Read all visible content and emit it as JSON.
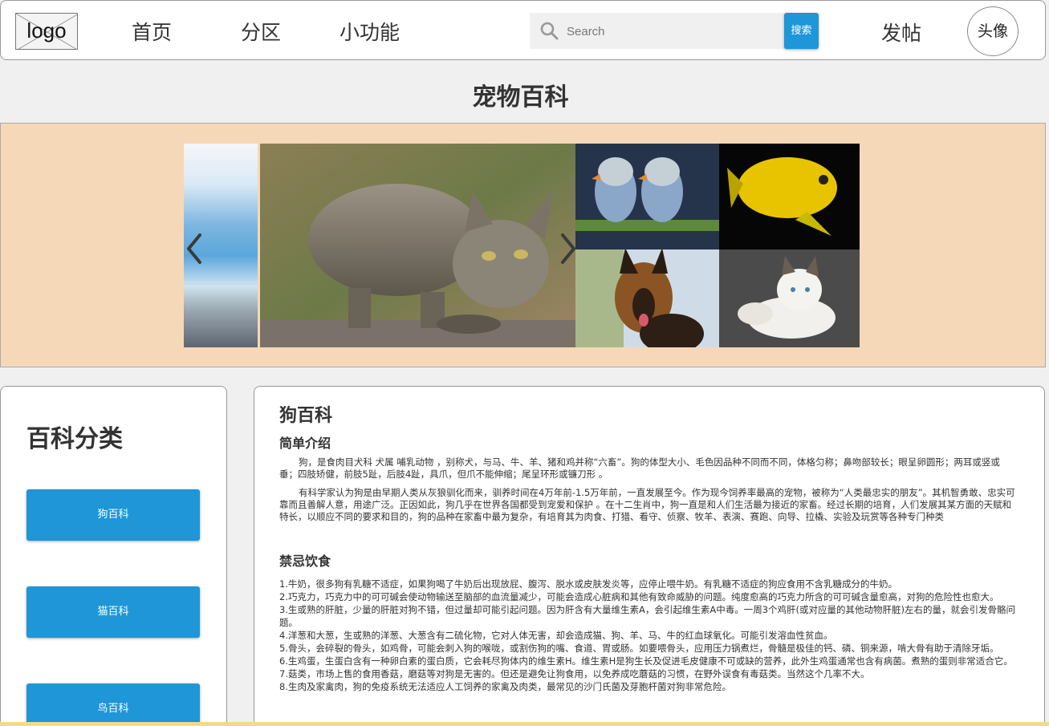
{
  "header": {
    "logo": "logo",
    "nav": [
      "首页",
      "分区",
      "小功能"
    ],
    "search_placeholder": "Search",
    "search_button": "搜索",
    "post_button": "发帖",
    "avatar": "头像"
  },
  "page_title": "宠物百科",
  "sidebar": {
    "title": "百科分类",
    "categories": [
      "狗百科",
      "猫百科",
      "鸟百科"
    ]
  },
  "content": {
    "title": "狗百科",
    "intro_heading": "简单介绍",
    "intro_paragraphs": [
      "狗，是食肉目犬科 犬属 哺乳动物 ，别称犬，与马、牛、羊、猪和鸡并称“六畜”。狗的体型大小、毛色因品种不同而不同，体格匀称；鼻吻部较长；眼呈卵圆形；两耳或竖或垂；四肢矫健，前肢5趾，后肢4趾，具爪，但爪不能伸缩；尾呈环形或镰刀形 。",
      "有科学家认为狗是由早期人类从灰狼驯化而来，驯养时间在4万年前-1.5万年前，一直发展至今。作为现今饲养率最高的宠物，被称为“人类最忠实的朋友”。其机智勇敢、忠实可靠而且善解人意，用途广泛。正因如此，狗几乎在世界各国都受到宠爱和保护 。在十二生肖中，狗一直是和人们生活最为接近的家畜。经过长期的培育，人们发展其某方面的天赋和特长，以顺应不同的要求和目的，狗的品种在家畜中最为复杂，有培育其为肉食、打猎、看守、侦察、牧羊、表演、赛跑、向导、拉橇、实验及玩赏等各种专门种类"
    ],
    "taboo_heading": "禁忌饮食",
    "taboo_items": [
      "1.牛奶，很多狗有乳糖不适症，如果狗喝了牛奶后出现放屁、腹泻、脱水或皮肤发炎等，应停止喂牛奶。有乳糖不适症的狗应食用不含乳糖成分的牛奶。",
      "2.巧克力，巧克力中的可可碱会使动物输送至脑部的血流量减少，可能会造成心脏病和其他有致命威胁的问题。纯度愈高的巧克力所含的可可碱含量愈高，对狗的危险性也愈大。",
      "3.生或熟的肝脏，少量的肝脏对狗不错，但过量却可能引起问题。因为肝含有大量维生素A，会引起维生素A中毒。一周3个鸡肝(或对应量的其他动物肝脏)左右的量，就会引发骨骼问题。",
      "4.洋葱和大葱，生或熟的洋葱、大葱含有二硫化物，它对人体无害，却会造成猫、狗、羊、马、牛的红血球氧化。可能引发溶血性贫血。",
      "5.骨头，会碎裂的骨头，如鸡骨，可能会刺入狗的喉咙，或割伤狗的嘴、食道、胃或肠。如要喂骨头，应用压力锅煮烂，骨髓是极佳的钙、磷、铜来源，啃大骨有助于清除牙垢。",
      "6.生鸡蛋，生蛋白含有一种卵白素的蛋白质，它会耗尽狗体内的维生素H。维生素H是狗生长及促进毛皮健康不可或缺的营养，此外生鸡蛋通常也含有病菌。煮熟的蛋则非常适合它。",
      "7.菇类，市场上售的食用香菇，磨菇等对狗是无害的。但还是避免让狗食用，以免养成吃蘑菇的习惯，在野外误食有毒菇类。当然这个几率不大。",
      "8.生肉及家禽肉，狗的免疫系统无法适应人工饲养的家禽及肉类，最常见的沙门氏菌及芽胞杆菌对狗非常危险。"
    ]
  },
  "colors": {
    "accent": "#1e96d8",
    "banner_bg": "#f5d8b8",
    "page_bg": "#f0f0f0"
  }
}
